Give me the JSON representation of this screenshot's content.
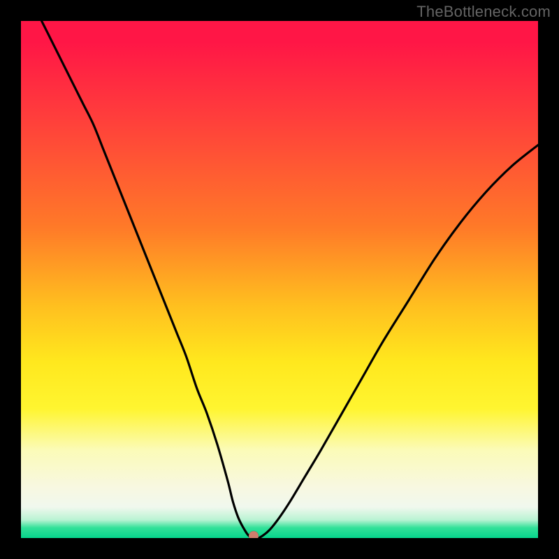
{
  "watermark": "TheBottleneck.com",
  "chart_data": {
    "type": "line",
    "title": "",
    "xlabel": "",
    "ylabel": "",
    "xlim": [
      0,
      100
    ],
    "ylim": [
      0,
      100
    ],
    "grid": false,
    "legend": false,
    "background": "red-yellow-green vertical gradient",
    "series": [
      {
        "name": "bottleneck-curve",
        "x": [
          4,
          6,
          8,
          10,
          12,
          14,
          16,
          18,
          20,
          22,
          24,
          26,
          28,
          30,
          32,
          34,
          36,
          38,
          40,
          41,
          42,
          43,
          44,
          45,
          46,
          48,
          50,
          52,
          55,
          58,
          62,
          66,
          70,
          75,
          80,
          85,
          90,
          95,
          100
        ],
        "y": [
          100,
          96,
          92,
          88,
          84,
          80,
          75,
          70,
          65,
          60,
          55,
          50,
          45,
          40,
          35,
          29,
          24,
          18,
          11,
          7,
          4,
          2,
          0.5,
          0,
          0,
          1.5,
          4,
          7,
          12,
          17,
          24,
          31,
          38,
          46,
          54,
          61,
          67,
          72,
          76
        ]
      }
    ],
    "marker": {
      "x": 45,
      "y": 0,
      "color": "#cf7d6d"
    },
    "notes": "V-shaped curve touching zero (green band) near x≈45; values estimated from pixel positions."
  }
}
